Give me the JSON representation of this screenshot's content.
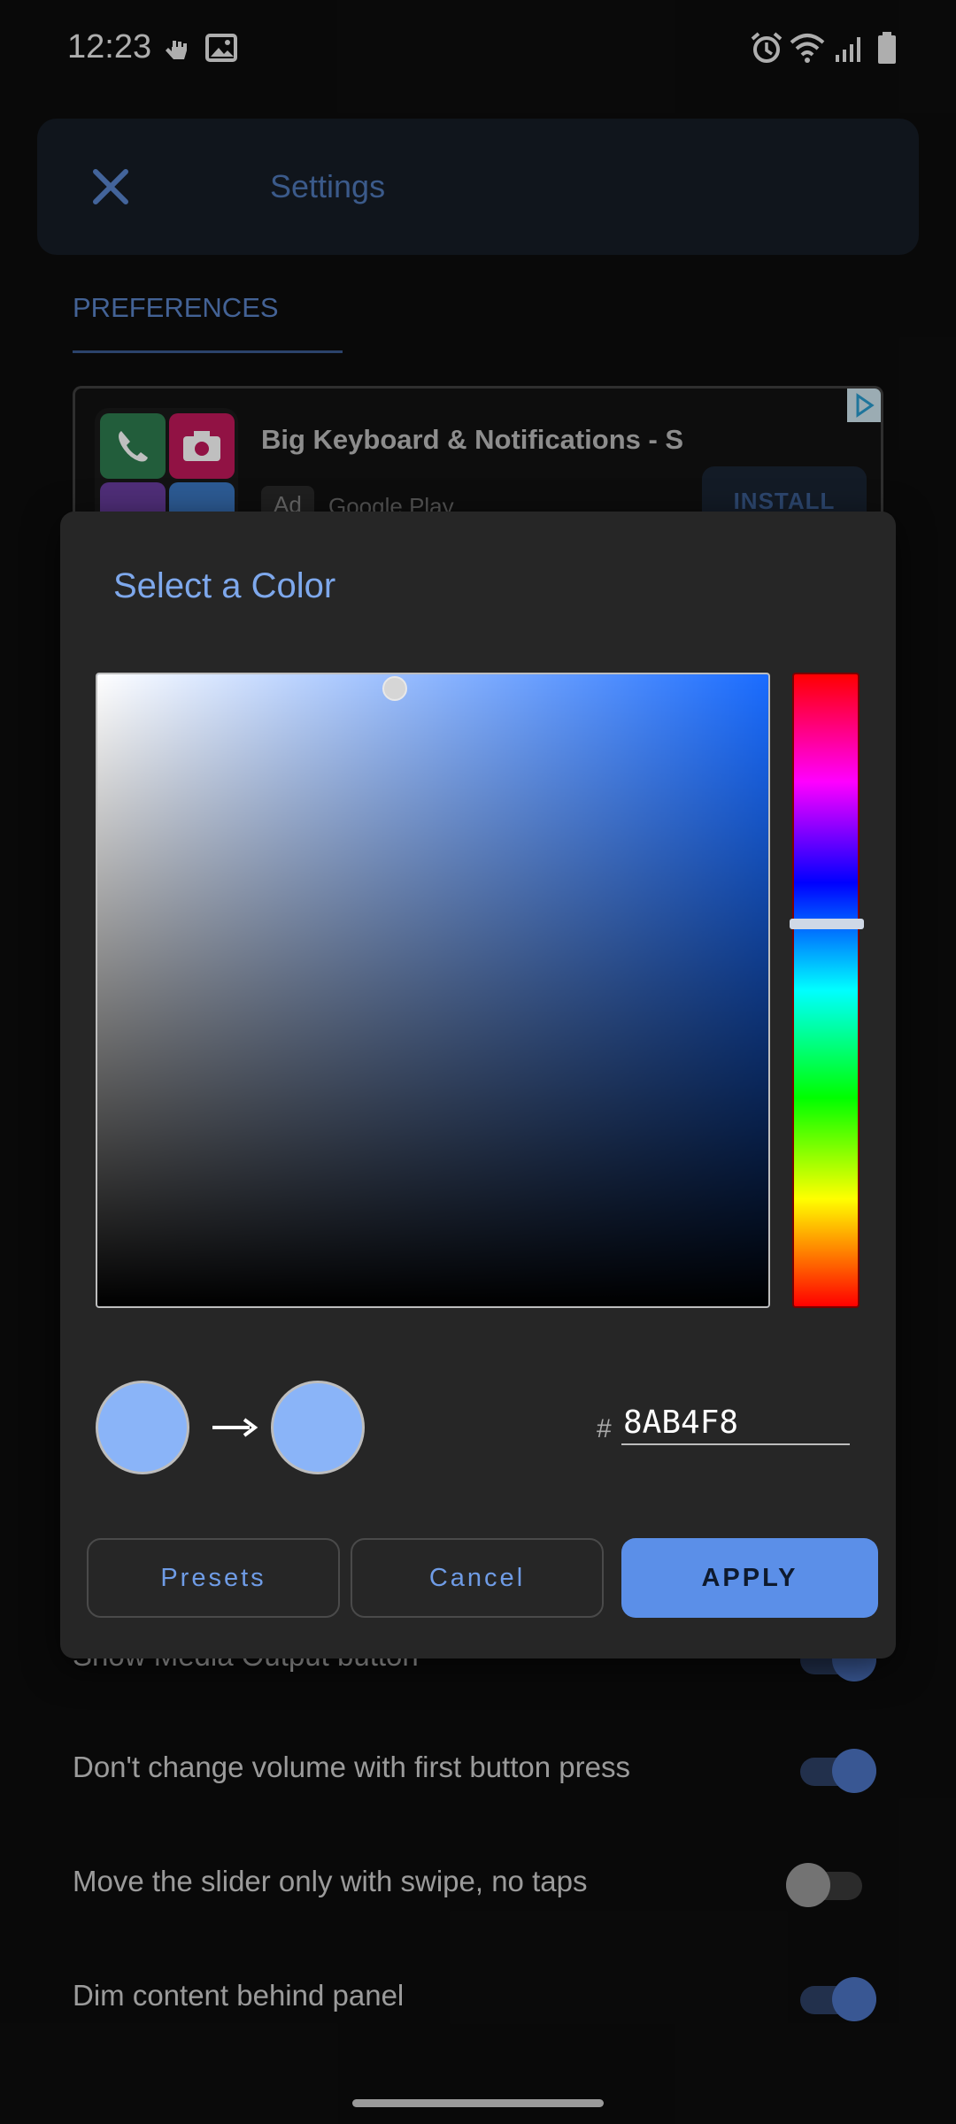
{
  "status_bar": {
    "time": "12:23"
  },
  "settings": {
    "title": "Settings",
    "tab": "PREFERENCES",
    "ad": {
      "title": "Big Keyboard & Notifications - S",
      "badge": "Ad",
      "store": "Google Play",
      "install": "INSTALL"
    },
    "rows": [
      {
        "label": "Show Media Output button",
        "on": true
      },
      {
        "label": "Don't change volume with first button press",
        "on": true
      },
      {
        "label": "Move the slider only with swipe, no taps",
        "on": false
      },
      {
        "label": "Dim content behind panel",
        "on": true
      }
    ]
  },
  "color_dialog": {
    "title": "Select a Color",
    "hex_prefix": "#",
    "hex_value": "8AB4F8",
    "old_color": "#8AB4F8",
    "new_color": "#8AB4F8",
    "hue_color": "#1a6cff",
    "buttons": {
      "presets": "Presets",
      "cancel": "Cancel",
      "apply": "APPLY"
    }
  }
}
